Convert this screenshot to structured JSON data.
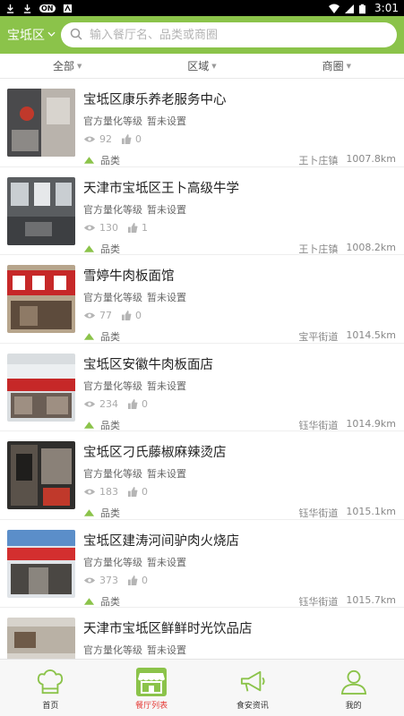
{
  "status_bar": {
    "time": "3:01",
    "badge": "ON"
  },
  "header": {
    "district": "宝坻区",
    "search_placeholder": "输入餐厅名、品类或商圈"
  },
  "filters": [
    {
      "label": "全部"
    },
    {
      "label": "区域"
    },
    {
      "label": "商圈"
    }
  ],
  "list": {
    "grade_label": "官方量化等级",
    "grade_value": "暂未设置",
    "category_label": "品类",
    "items": [
      {
        "name": "宝坻区康乐养老服务中心",
        "views": "92",
        "likes": "0",
        "area": "王卜庄镇",
        "distance": "1007.8km"
      },
      {
        "name": "天津市宝坻区王卜高级牛学",
        "views": "130",
        "likes": "1",
        "area": "王卜庄镇",
        "distance": "1008.2km"
      },
      {
        "name": "雪婷牛肉板面馆",
        "views": "77",
        "likes": "0",
        "area": "宝平街道",
        "distance": "1014.5km"
      },
      {
        "name": "宝坻区安徽牛肉板面店",
        "views": "234",
        "likes": "0",
        "area": "钰华街道",
        "distance": "1014.9km"
      },
      {
        "name": "宝坻区刁氏藤椒麻辣烫店",
        "views": "183",
        "likes": "0",
        "area": "钰华街道",
        "distance": "1015.1km"
      },
      {
        "name": "宝坻区建涛河间驴肉火烧店",
        "views": "373",
        "likes": "0",
        "area": "钰华街道",
        "distance": "1015.7km"
      },
      {
        "name": "天津市宝坻区鲜鲜时光饮品店",
        "views": "",
        "likes": "",
        "area": "",
        "distance": ""
      }
    ]
  },
  "bottom_nav": [
    {
      "label": "首页",
      "icon": "chef-hat-icon"
    },
    {
      "label": "餐厅列表",
      "icon": "storefront-icon"
    },
    {
      "label": "食安资讯",
      "icon": "megaphone-icon"
    },
    {
      "label": "我的",
      "icon": "user-icon"
    }
  ],
  "colors": {
    "brand_green": "#8bc34a",
    "active_red": "#e53935"
  }
}
